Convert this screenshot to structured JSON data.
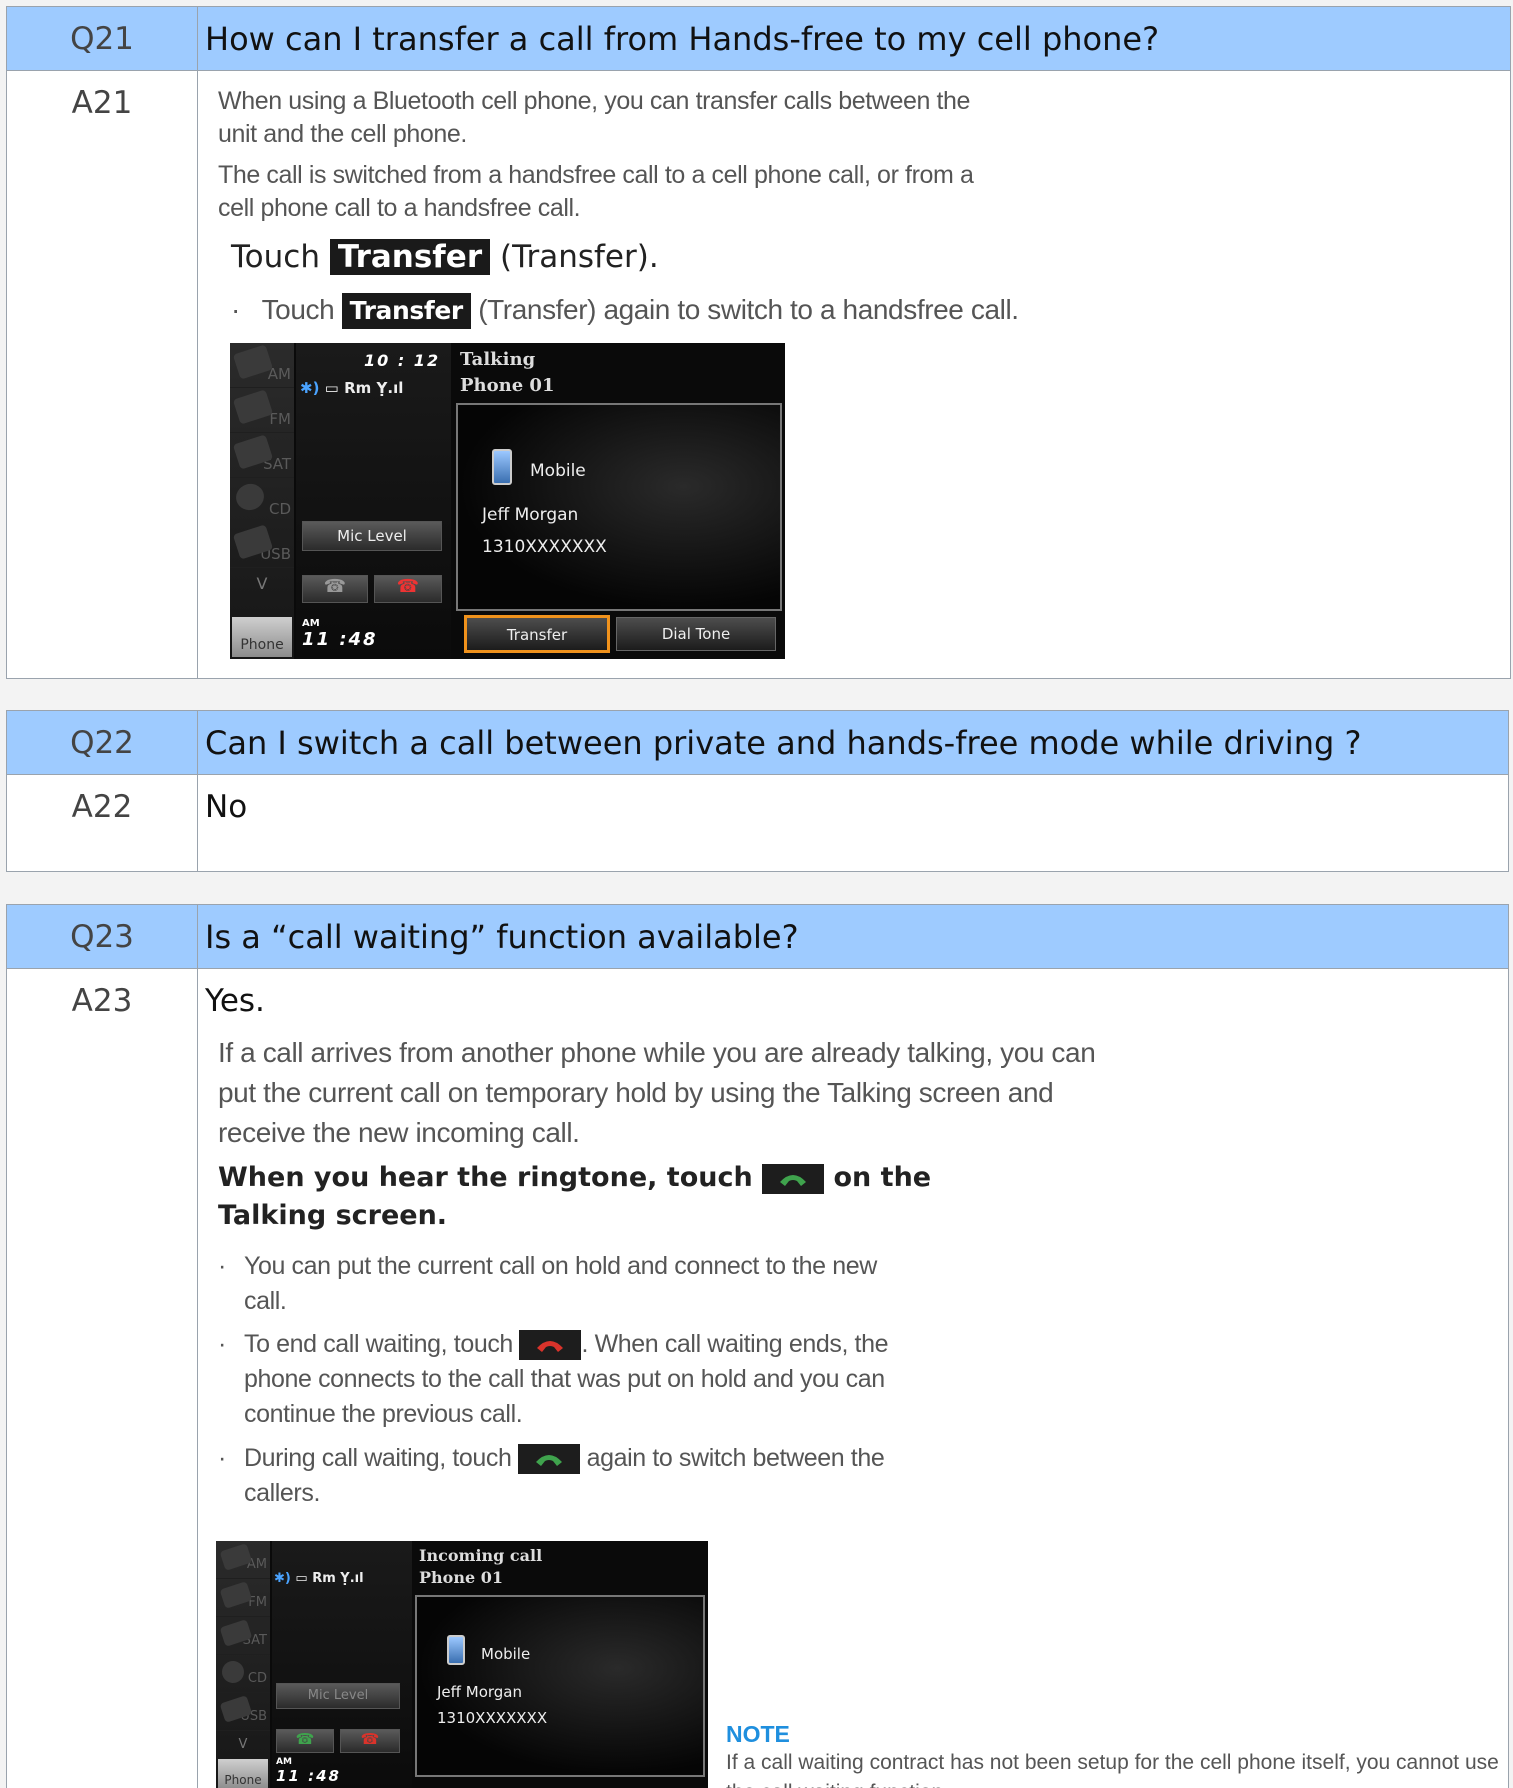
{
  "q21": {
    "num": "Q21",
    "question": "How can I transfer a call from Hands-free to my cell phone?",
    "anum": "A21",
    "para1": "When using a Bluetooth cell phone, you can transfer calls between the unit and the cell phone.",
    "para2": "The call is switched from a handsfree call to a cell phone call, or from a cell phone call to a handsfree call.",
    "step_touch": "Touch",
    "step_button": "Transfer",
    "step_suffix": "(Transfer).",
    "bullet_touch": "Touch",
    "bullet_button": "Transfer",
    "bullet_suffix": "(Transfer) again to switch to a handsfree call.",
    "screen": {
      "side_items": [
        "AM",
        "FM",
        "SAT",
        "CD",
        "USB"
      ],
      "side_down": "V",
      "phone_tab": "Phone",
      "time": "10 : 12",
      "status_line": "Rm",
      "header_line1": "Talking",
      "header_line2": "Phone 01",
      "mobile_label": "Mobile",
      "contact_name": "Jeff Morgan",
      "contact_number": "1310XXXXXXX",
      "mic_level": "Mic Level",
      "clock_ampm": "AM",
      "clock": "11 :48",
      "btn_transfer": "Transfer",
      "btn_dialtone": "Dial Tone",
      "highlight_color": "#f0921c"
    }
  },
  "q22": {
    "num": "Q22",
    "question": "Can I switch a call between private and hands-free mode while driving ?",
    "anum": "A22",
    "answer": "No"
  },
  "q23": {
    "num": "Q23",
    "question": "Is a “call waiting” function available?",
    "anum": "A23",
    "answer": "Yes.",
    "intro": "If a call arrives from another phone while you are already talking, you can put the current call on temporary hold by using the Talking screen and receive the new incoming call.",
    "step_pre": "When you hear the ringtone, touch",
    "step_post": "on the Talking screen.",
    "bullet1": "You can put the current call on hold and connect to the new call.",
    "bullet2_pre": "To end call waiting, touch",
    "bullet2_post": ". When call waiting ends, the phone connects to the call that was put on hold and you can continue the previous call.",
    "bullet3_pre": "During call waiting, touch",
    "bullet3_post": "again to switch between the callers.",
    "screen": {
      "side_items": [
        "AM",
        "FM",
        "SAT",
        "CD",
        "USB"
      ],
      "side_down": "V",
      "phone_tab": "Phone",
      "status_line": "Rm",
      "header_line1": "Incoming call",
      "header_line2": "Phone 01",
      "mobile_label": "Mobile",
      "contact_name": "Jeff Morgan",
      "contact_number": "1310XXXXXXX",
      "mic_level": "Mic Level",
      "clock_ampm": "AM",
      "clock": "11 :48"
    },
    "note_title": "NOTE",
    "note_text": "If a call waiting contract has not been setup for the cell phone itself, you cannot use the call waiting function."
  },
  "colors": {
    "header_bg": "#9ecbff",
    "border": "#9aa3ad",
    "accept_green": "#3fa34d",
    "reject_red": "#d9332b",
    "note_blue": "#1f8fde"
  }
}
